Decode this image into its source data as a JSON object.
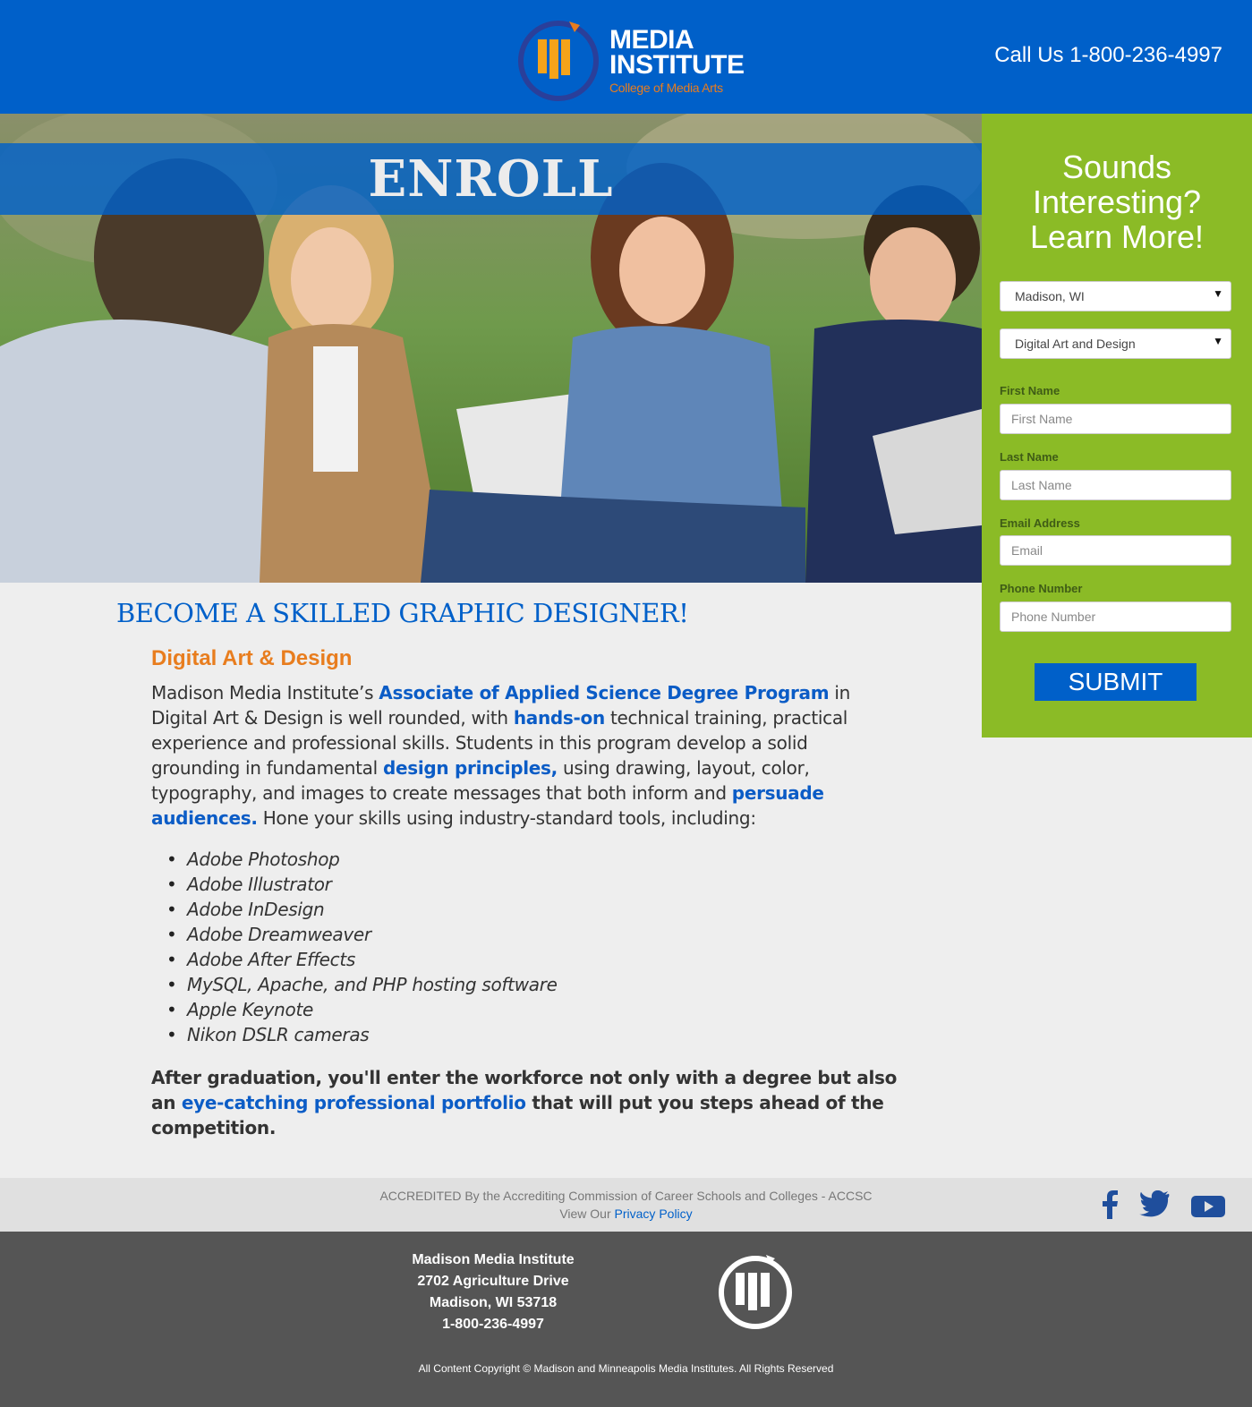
{
  "header": {
    "logo_line1": "MEDIA",
    "logo_line2": "INSTITUTE",
    "logo_tagline": "College of Media Arts",
    "call_text": "Call Us 1-800-236-4997"
  },
  "hero": {
    "banner": "ENROLL"
  },
  "form": {
    "title_line1": "Sounds",
    "title_line2": "Interesting?",
    "title_line3": "Learn More!",
    "campus_select": "Madison, WI",
    "program_select": "Digital Art and Design",
    "first_name_label": "First Name",
    "first_name_placeholder": "First Name",
    "last_name_label": "Last Name",
    "last_name_placeholder": "Last Name",
    "email_label": "Email Address",
    "email_placeholder": "Email",
    "phone_label": "Phone Number",
    "phone_placeholder": "Phone Number",
    "submit_label": "SUBMIT"
  },
  "content": {
    "heading": "BECOME A SKILLED GRAPHIC DESIGNER!",
    "subheading": "Digital Art & Design",
    "para_1": "Madison Media Institute’s ",
    "para_link_1": "Associate of Applied Science Degree Program",
    "para_2": " in Digital Art & Design is well rounded, with ",
    "para_link_2": "hands-on",
    "para_3": " technical training, practical experience and professional skills. Students in this program develop a solid grounding in fundamental ",
    "para_link_3": "design principles,",
    "para_4": " using drawing, layout, color, typography, and images to create messages that both inform and ",
    "para_link_4": "persuade audiences.",
    "para_5": " Hone your skills using industry-standard tools, including:",
    "tools": [
      "Adobe Photoshop",
      "Adobe Illustrator",
      "Adobe InDesign",
      "Adobe Dreamweaver",
      "Adobe After Effects",
      "MySQL, Apache, and PHP hosting software",
      "Apple Keynote",
      "Nikon DSLR cameras"
    ],
    "closing_1": "After graduation, you'll enter the workforce not only with a degree but also an ",
    "closing_link": "eye-catching professional portfolio",
    "closing_2": " that will put you steps ahead of the competition."
  },
  "accreditation": {
    "line1": "ACCREDITED By the Accrediting Commission of Career Schools and Colleges - ACCSC",
    "line2_prefix": "View Our ",
    "line2_link": "Privacy Policy"
  },
  "social": {
    "icons": [
      "facebook-icon",
      "twitter-icon",
      "youtube-icon"
    ],
    "color": "#1f4e9c"
  },
  "footer": {
    "address": [
      "Madison Media Institute",
      "2702 Agriculture Drive",
      "Madison, WI 53718",
      "1-800-236-4997"
    ],
    "copyright": "All Content Copyright © Madison and Minneapolis Media Institutes. All Rights Reserved"
  },
  "colors": {
    "brand_blue": "#0060c9",
    "accent_orange": "#e87d1e",
    "form_green": "#8bbb26",
    "footer_gray": "#555555"
  }
}
